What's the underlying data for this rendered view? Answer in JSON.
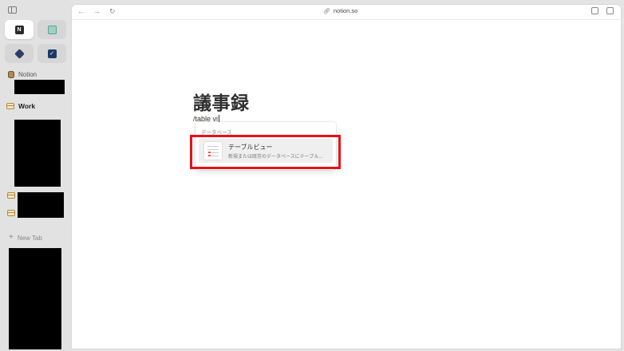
{
  "sidebar": {
    "sections": [
      {
        "label": "Notion"
      },
      {
        "label": "Work"
      }
    ],
    "new_tab_label": "New Tab"
  },
  "browser": {
    "url": "notion.so"
  },
  "page": {
    "title": "議事録",
    "input_text": "/table vi"
  },
  "menu": {
    "section_label": "データベース",
    "items": [
      {
        "title": "テーブルビュー",
        "description": "新規または既存のデータベースにテーブル..."
      }
    ]
  },
  "colors": {
    "highlight": "#e8101a",
    "sidebar_bg": "#e2e2e2",
    "item_hover": "#efefef"
  }
}
